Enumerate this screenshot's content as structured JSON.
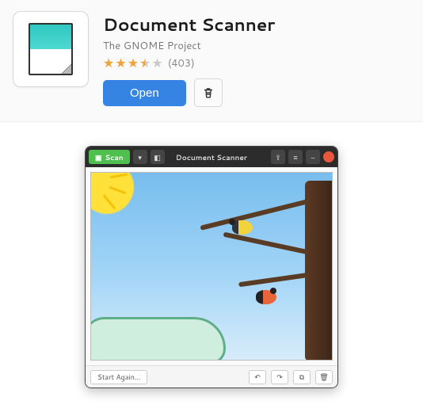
{
  "app": {
    "name": "Document Scanner",
    "publisher": "The GNOME Project",
    "rating_stars": 3.5,
    "review_count": "(403)",
    "open_label": "Open",
    "uninstall_icon": "trash-icon"
  },
  "screenshot_window": {
    "title": "Document Scanner",
    "scan_label": "Scan",
    "bottombar": {
      "start_again": "Start Again…"
    }
  }
}
